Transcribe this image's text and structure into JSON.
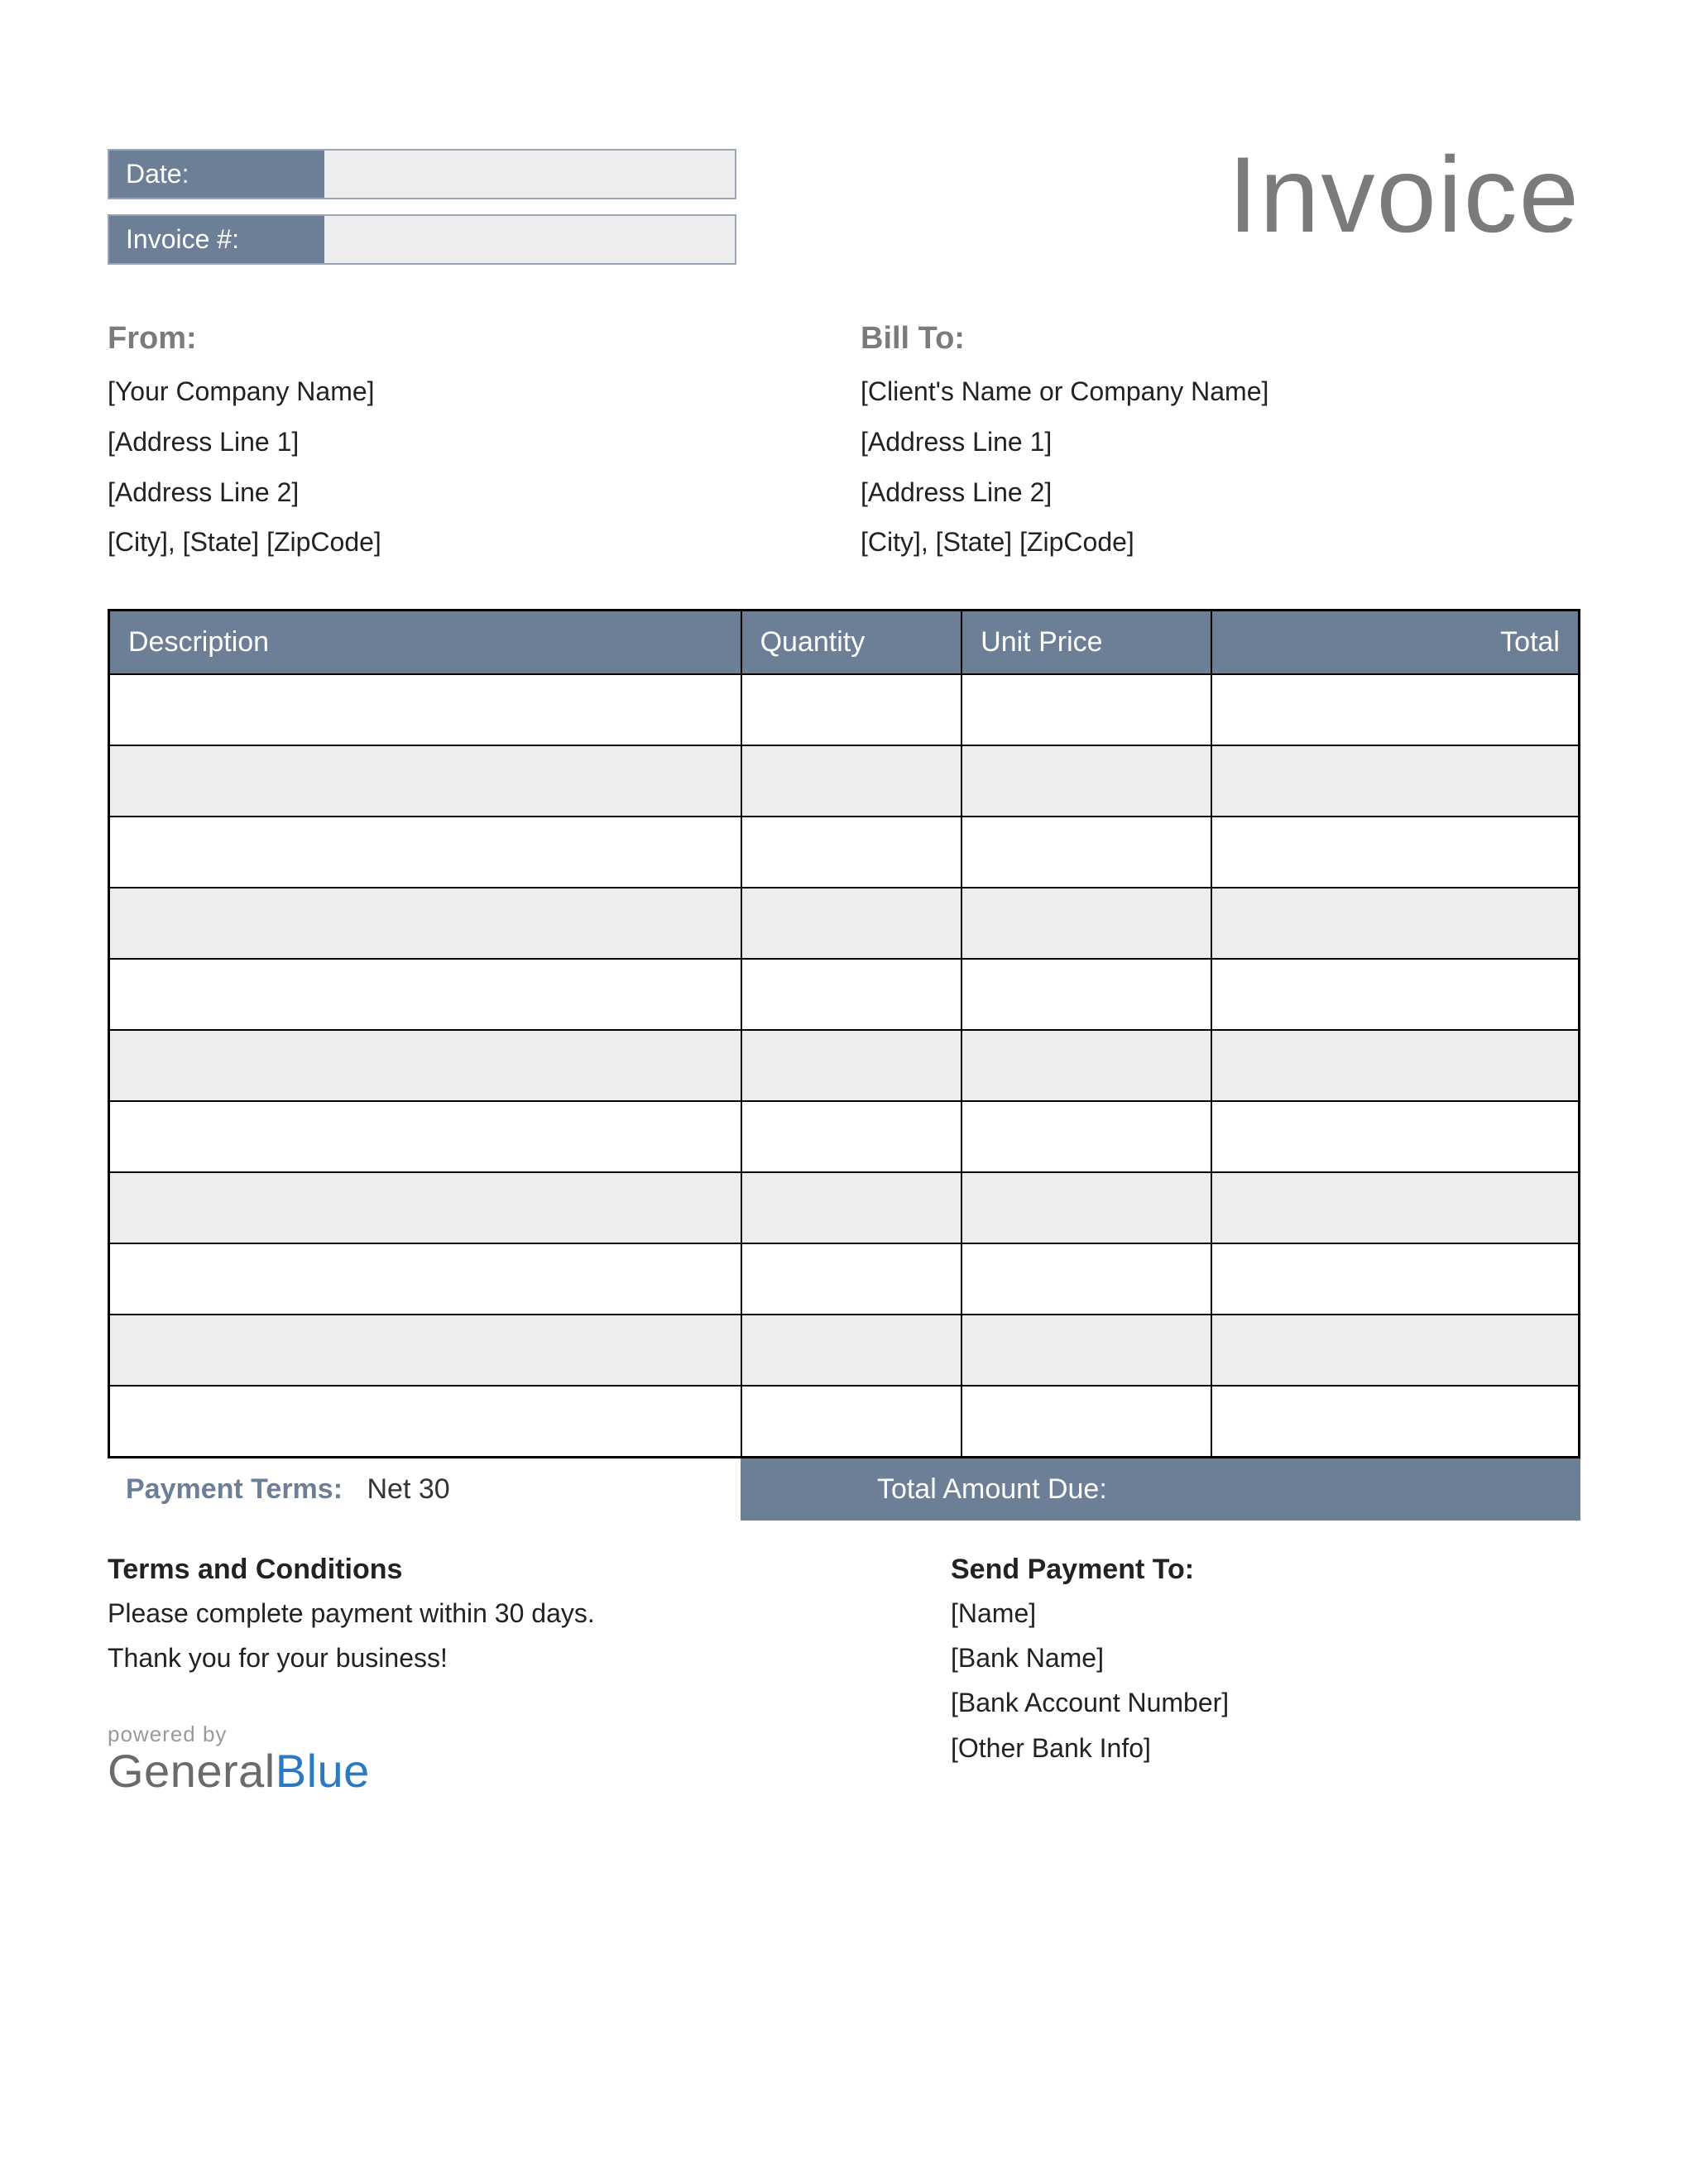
{
  "title": "Invoice",
  "meta": {
    "date_label": "Date:",
    "date_value": "",
    "invoice_num_label": "Invoice #:",
    "invoice_num_value": ""
  },
  "from": {
    "heading": "From:",
    "lines": [
      "[Your Company Name]",
      "[Address Line 1]",
      "[Address Line 2]",
      "[City], [State] [ZipCode]"
    ]
  },
  "bill_to": {
    "heading": "Bill To:",
    "lines": [
      "[Client's Name or Company Name]",
      "[Address Line 1]",
      "[Address Line 2]",
      "[City], [State] [ZipCode]"
    ]
  },
  "table": {
    "headers": {
      "description": "Description",
      "quantity": "Quantity",
      "unit_price": "Unit Price",
      "total": "Total"
    },
    "rows": [
      {
        "description": "",
        "quantity": "",
        "unit_price": "",
        "total": ""
      },
      {
        "description": "",
        "quantity": "",
        "unit_price": "",
        "total": ""
      },
      {
        "description": "",
        "quantity": "",
        "unit_price": "",
        "total": ""
      },
      {
        "description": "",
        "quantity": "",
        "unit_price": "",
        "total": ""
      },
      {
        "description": "",
        "quantity": "",
        "unit_price": "",
        "total": ""
      },
      {
        "description": "",
        "quantity": "",
        "unit_price": "",
        "total": ""
      },
      {
        "description": "",
        "quantity": "",
        "unit_price": "",
        "total": ""
      },
      {
        "description": "",
        "quantity": "",
        "unit_price": "",
        "total": ""
      },
      {
        "description": "",
        "quantity": "",
        "unit_price": "",
        "total": ""
      },
      {
        "description": "",
        "quantity": "",
        "unit_price": "",
        "total": ""
      },
      {
        "description": "",
        "quantity": "",
        "unit_price": "",
        "total": ""
      }
    ]
  },
  "payment_terms": {
    "label": "Payment Terms:",
    "value": "Net 30"
  },
  "total_due": {
    "label": "Total Amount Due:",
    "value": ""
  },
  "terms": {
    "heading": "Terms and Conditions",
    "text1": "Please complete payment within 30 days.",
    "text2": "Thank you for your business!"
  },
  "send_payment": {
    "heading": "Send Payment To:",
    "lines": [
      "[Name]",
      "[Bank Name]",
      "[Bank Account Number]",
      "[Other Bank Info]"
    ]
  },
  "footer": {
    "powered": "powered by",
    "brand1": "General",
    "brand2": "Blue"
  }
}
